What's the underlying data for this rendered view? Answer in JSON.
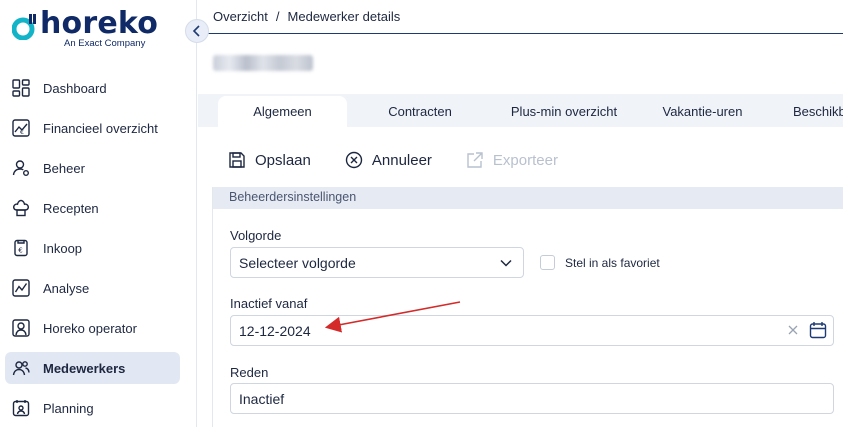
{
  "brand": {
    "name": "horeko",
    "tagline": "An Exact Company",
    "color": "#0f2a66",
    "accent": "#13b4c8"
  },
  "sidebar": {
    "items": [
      {
        "label": "Dashboard",
        "icon": "dashboard-icon",
        "active": false
      },
      {
        "label": "Financieel overzicht",
        "icon": "finance-icon",
        "active": false
      },
      {
        "label": "Beheer",
        "icon": "user-settings-icon",
        "active": false
      },
      {
        "label": "Recepten",
        "icon": "chef-hat-icon",
        "active": false
      },
      {
        "label": "Inkoop",
        "icon": "purchase-icon",
        "active": false
      },
      {
        "label": "Analyse",
        "icon": "chart-icon",
        "active": false
      },
      {
        "label": "Horeko operator",
        "icon": "operator-icon",
        "active": false
      },
      {
        "label": "Medewerkers",
        "icon": "employees-icon",
        "active": true
      },
      {
        "label": "Planning",
        "icon": "planning-icon",
        "active": false
      }
    ]
  },
  "breadcrumb": {
    "root": "Overzicht",
    "separator": "/",
    "current": "Medewerker details"
  },
  "tabs": [
    {
      "label": "Algemeen",
      "active": true
    },
    {
      "label": "Contracten",
      "active": false
    },
    {
      "label": "Plus-min overzicht",
      "active": false
    },
    {
      "label": "Vakantie-uren",
      "active": false
    },
    {
      "label": "Beschikb",
      "active": false
    }
  ],
  "toolbar": {
    "save_label": "Opslaan",
    "cancel_label": "Annuleer",
    "export_label": "Exporteer"
  },
  "section": {
    "title": "Beheerdersinstellingen",
    "order_label": "Volgorde",
    "order_value": "Selecteer volgorde",
    "favorite_label": "Stel in als favoriet",
    "favorite_checked": false,
    "inactive_label": "Inactief vanaf",
    "inactive_value": "12-12-2024",
    "reason_label": "Reden",
    "reason_value": "Inactief"
  },
  "annotation_color": "#d42a2a"
}
